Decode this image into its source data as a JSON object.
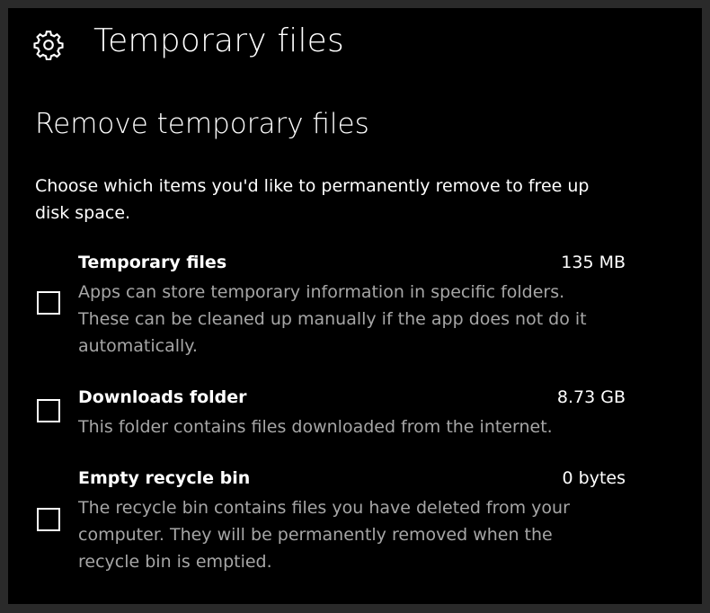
{
  "window": {
    "title": "Temporary files",
    "icon": "gear-icon"
  },
  "section": {
    "title": "Remove temporary files",
    "description": "Choose which items you'd like to permanently remove to free up disk space."
  },
  "items": [
    {
      "name": "Temporary files",
      "size": "135 MB",
      "description": "Apps can store temporary information in specific folders. These can be cleaned up manually if the app does not do it automatically.",
      "checked": false
    },
    {
      "name": "Downloads folder",
      "size": "8.73 GB",
      "description": "This folder contains files downloaded from the internet.",
      "checked": false
    },
    {
      "name": "Empty recycle bin",
      "size": "0 bytes",
      "description": "The recycle bin contains files you have deleted from your computer. They will be permanently removed when the recycle bin is emptied.",
      "checked": false
    }
  ],
  "colors": {
    "background": "#000000",
    "text": "#ffffff",
    "secondary_text": "#a6a6a6"
  }
}
